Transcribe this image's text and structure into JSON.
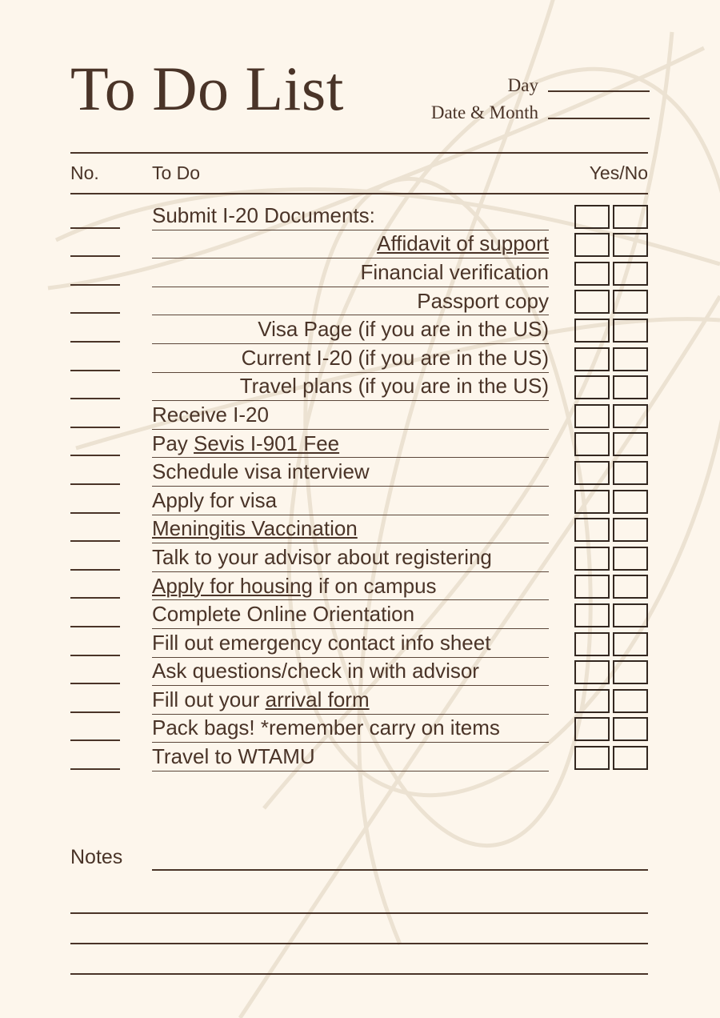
{
  "document": {
    "title": "To Do List",
    "background_color": "#fdf6ec",
    "text_color": "#4a3428",
    "decor_color": "#efe6d8"
  },
  "header": {
    "day_label": "Day",
    "date_month_label": "Date & Month",
    "day_value": "",
    "date_month_value": ""
  },
  "table": {
    "columns": {
      "no": "No.",
      "todo": "To Do",
      "yesno": "Yes/No"
    },
    "rows": [
      {
        "no": "",
        "align": "left",
        "segments": [
          {
            "text": "Submit I-20 Documents:",
            "link": false
          }
        ],
        "yes": false,
        "no_checked": false
      },
      {
        "no": "",
        "align": "right",
        "segments": [
          {
            "text": "Affidavit of support",
            "link": true
          }
        ],
        "yes": false,
        "no_checked": false
      },
      {
        "no": "",
        "align": "right",
        "segments": [
          {
            "text": "Financial verification",
            "link": false
          }
        ],
        "yes": false,
        "no_checked": false
      },
      {
        "no": "",
        "align": "right",
        "segments": [
          {
            "text": "Passport copy",
            "link": false
          }
        ],
        "yes": false,
        "no_checked": false
      },
      {
        "no": "",
        "align": "right",
        "segments": [
          {
            "text": "Visa Page (if you are in the US)",
            "link": false
          }
        ],
        "yes": false,
        "no_checked": false
      },
      {
        "no": "",
        "align": "right",
        "segments": [
          {
            "text": "Current I-20 (if you are in the US)",
            "link": false
          }
        ],
        "yes": false,
        "no_checked": false
      },
      {
        "no": "",
        "align": "right",
        "segments": [
          {
            "text": "Travel plans (if you are in the US)",
            "link": false
          }
        ],
        "yes": false,
        "no_checked": false
      },
      {
        "no": "",
        "align": "left",
        "segments": [
          {
            "text": "Receive I-20",
            "link": false
          }
        ],
        "yes": false,
        "no_checked": false
      },
      {
        "no": "",
        "align": "left",
        "segments": [
          {
            "text": "Pay ",
            "link": false
          },
          {
            "text": "Sevis I-901 Fee",
            "link": true
          }
        ],
        "yes": false,
        "no_checked": false
      },
      {
        "no": "",
        "align": "left",
        "segments": [
          {
            "text": "Schedule visa interview",
            "link": false
          }
        ],
        "yes": false,
        "no_checked": false
      },
      {
        "no": "",
        "align": "left",
        "segments": [
          {
            "text": "Apply for visa",
            "link": false
          }
        ],
        "yes": false,
        "no_checked": false
      },
      {
        "no": "",
        "align": "left",
        "segments": [
          {
            "text": "Meningitis Vaccination",
            "link": true
          }
        ],
        "yes": false,
        "no_checked": false
      },
      {
        "no": "",
        "align": "left",
        "segments": [
          {
            "text": "Talk to your advisor about registering",
            "link": false
          }
        ],
        "yes": false,
        "no_checked": false
      },
      {
        "no": "",
        "align": "left",
        "segments": [
          {
            "text": "Apply for housing",
            "link": true
          },
          {
            "text": " if on campus",
            "link": false
          }
        ],
        "yes": false,
        "no_checked": false
      },
      {
        "no": "",
        "align": "left",
        "segments": [
          {
            "text": "Complete Online Orientation",
            "link": false
          }
        ],
        "yes": false,
        "no_checked": false
      },
      {
        "no": "",
        "align": "left",
        "segments": [
          {
            "text": "Fill out emergency contact info sheet",
            "link": false
          }
        ],
        "yes": false,
        "no_checked": false
      },
      {
        "no": "",
        "align": "left",
        "segments": [
          {
            "text": "Ask questions/check in with advisor",
            "link": false
          }
        ],
        "yes": false,
        "no_checked": false
      },
      {
        "no": "",
        "align": "left",
        "segments": [
          {
            "text": "Fill out your ",
            "link": false
          },
          {
            "text": "arrival form",
            "link": true
          }
        ],
        "yes": false,
        "no_checked": false
      },
      {
        "no": "",
        "align": "left",
        "segments": [
          {
            "text": "Pack bags!  *remember carry on items",
            "link": false
          }
        ],
        "yes": false,
        "no_checked": false
      },
      {
        "no": "",
        "align": "left",
        "segments": [
          {
            "text": "Travel to WTAMU",
            "link": false
          }
        ],
        "yes": false,
        "no_checked": false
      }
    ]
  },
  "notes": {
    "label": "Notes",
    "lines": [
      "",
      "",
      "",
      ""
    ]
  }
}
